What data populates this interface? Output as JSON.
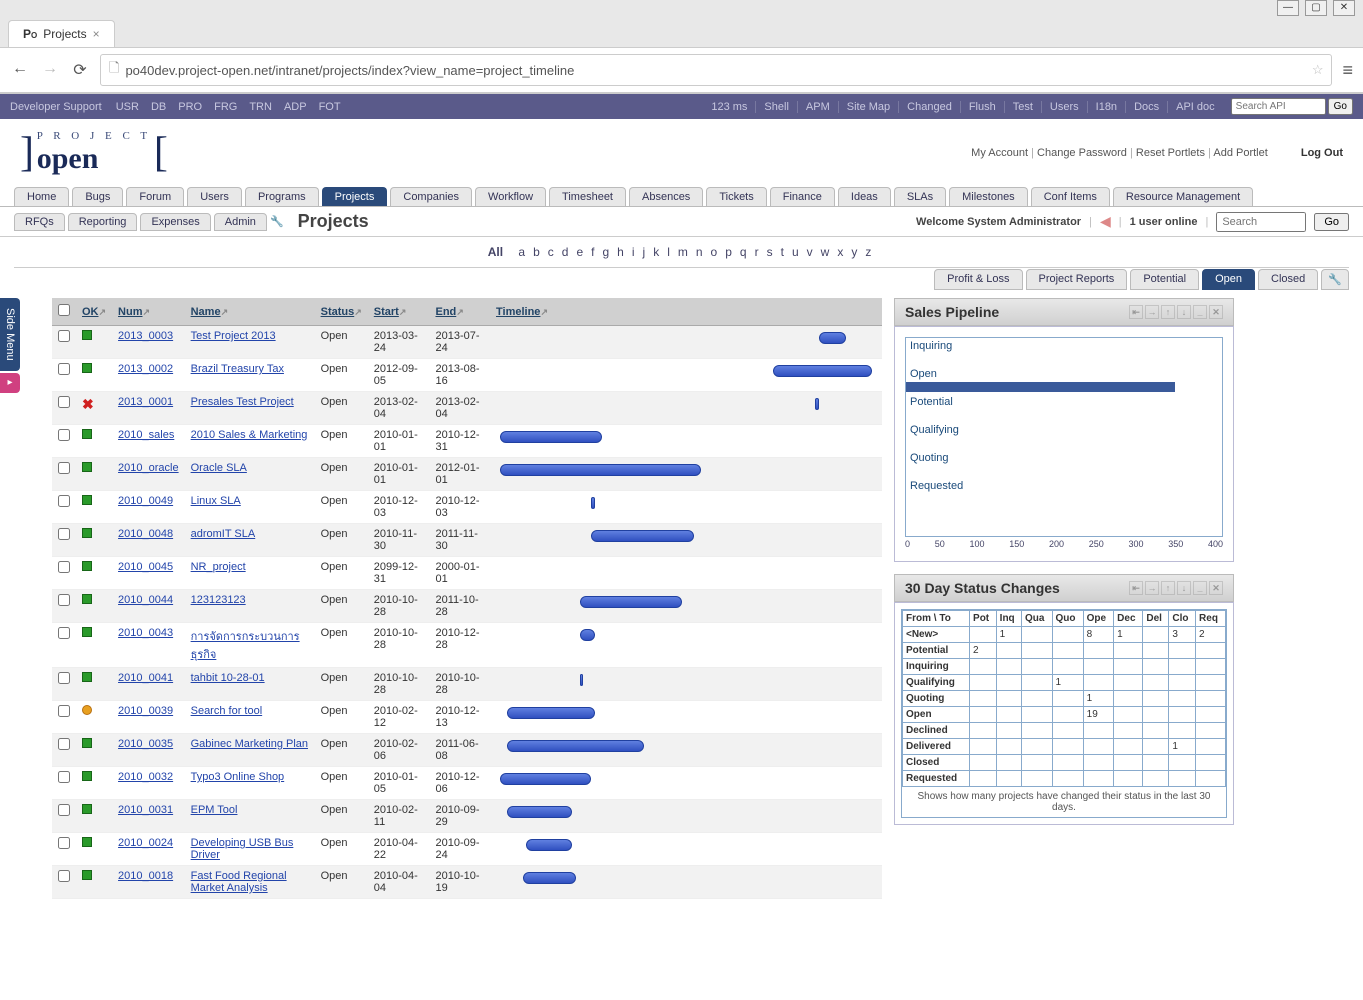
{
  "browser": {
    "tab_title": "Projects",
    "url": "po40dev.project-open.net/intranet/projects/index?view_name=project_timeline",
    "min_label": "—",
    "max_label": "▢",
    "close_label": "✕"
  },
  "dev_bar": {
    "label": "Developer Support",
    "left": [
      "USR",
      "DB",
      "PRO",
      "FRG",
      "TRN",
      "ADP",
      "FOT"
    ],
    "right": [
      "123 ms",
      "Shell",
      "APM",
      "Site Map",
      "Changed",
      "Flush",
      "Test",
      "Users",
      "I18n",
      "Docs",
      "API doc"
    ],
    "search_placeholder": "Search API",
    "go": "Go"
  },
  "header": {
    "account_links": [
      "My Account",
      "Change Password",
      "Reset Portlets",
      "Add Portlet"
    ],
    "logout": "Log Out",
    "logo_top": "P R O J E C T",
    "logo_bottom": "open"
  },
  "main_tabs": [
    "Home",
    "Bugs",
    "Forum",
    "Users",
    "Programs",
    "Projects",
    "Companies",
    "Workflow",
    "Timesheet",
    "Absences",
    "Tickets",
    "Finance",
    "Ideas",
    "SLAs",
    "Milestones",
    "Conf Items",
    "Resource Management"
  ],
  "main_tab_active": "Projects",
  "sub_tabs": [
    "RFQs",
    "Reporting",
    "Expenses",
    "Admin"
  ],
  "page_title": "Projects",
  "welcome": {
    "text": "Welcome System Administrator",
    "online": "1 user online",
    "search_placeholder": "Search",
    "go": "Go"
  },
  "alpha": {
    "all": "All",
    "letters": [
      "a",
      "b",
      "c",
      "d",
      "e",
      "f",
      "g",
      "h",
      "i",
      "j",
      "k",
      "l",
      "m",
      "n",
      "o",
      "p",
      "q",
      "r",
      "s",
      "t",
      "u",
      "v",
      "w",
      "x",
      "y",
      "z"
    ]
  },
  "view_tabs": [
    "Profit & Loss",
    "Project Reports",
    "Potential",
    "Open",
    "Closed"
  ],
  "view_tab_active": "Open",
  "columns": {
    "ok": "OK",
    "num": "Num",
    "name": "Name",
    "status": "Status",
    "start": "Start",
    "end": "End",
    "timeline": "Timeline"
  },
  "side_menu_label": "Side Menu",
  "projects": [
    {
      "ok": "green",
      "num": "2013_0003",
      "name": "Test Project 2013",
      "status": "Open",
      "start": "2013-03-24",
      "end": "2013-07-24",
      "tl_left": 85,
      "tl_width": 7
    },
    {
      "ok": "green",
      "num": "2013_0002",
      "name": "Brazil Treasury Tax",
      "status": "Open",
      "start": "2012-09-05",
      "end": "2013-08-16",
      "tl_left": 73,
      "tl_width": 26
    },
    {
      "ok": "red",
      "num": "2013_0001",
      "name": "Presales Test Project",
      "status": "Open",
      "start": "2013-02-04",
      "end": "2013-02-04",
      "tl_left": 84,
      "tl_width": 1
    },
    {
      "ok": "green",
      "num": "2010_sales",
      "name": "2010 Sales & Marketing",
      "status": "Open",
      "start": "2010-01-01",
      "end": "2010-12-31",
      "tl_left": 1,
      "tl_width": 27
    },
    {
      "ok": "green",
      "num": "2010_oracle",
      "name": "Oracle SLA",
      "status": "Open",
      "start": "2010-01-01",
      "end": "2012-01-01",
      "tl_left": 1,
      "tl_width": 53
    },
    {
      "ok": "green",
      "num": "2010_0049",
      "name": "Linux SLA",
      "status": "Open",
      "start": "2010-12-03",
      "end": "2010-12-03",
      "tl_left": 25,
      "tl_width": 1
    },
    {
      "ok": "green",
      "num": "2010_0048",
      "name": "adromIT SLA",
      "status": "Open",
      "start": "2010-11-30",
      "end": "2011-11-30",
      "tl_left": 25,
      "tl_width": 27
    },
    {
      "ok": "green",
      "num": "2010_0045",
      "name": "NR_project",
      "status": "Open",
      "start": "2099-12-31",
      "end": "2000-01-01",
      "tl_left": 0,
      "tl_width": 0
    },
    {
      "ok": "green",
      "num": "2010_0044",
      "name": "123123123",
      "status": "Open",
      "start": "2010-10-28",
      "end": "2011-10-28",
      "tl_left": 22,
      "tl_width": 27
    },
    {
      "ok": "green",
      "num": "2010_0043",
      "name": "การจัดการกระบวนการธุรกิจ",
      "status": "Open",
      "start": "2010-10-28",
      "end": "2010-12-28",
      "tl_left": 22,
      "tl_width": 4
    },
    {
      "ok": "green",
      "num": "2010_0041",
      "name": "tahbit 10-28-01",
      "status": "Open",
      "start": "2010-10-28",
      "end": "2010-10-28",
      "tl_left": 22,
      "tl_width": 1
    },
    {
      "ok": "orange",
      "num": "2010_0039",
      "name": "Search for tool",
      "status": "Open",
      "start": "2010-02-12",
      "end": "2010-12-13",
      "tl_left": 3,
      "tl_width": 23
    },
    {
      "ok": "green",
      "num": "2010_0035",
      "name": "Gabinec Marketing Plan",
      "status": "Open",
      "start": "2010-02-06",
      "end": "2011-06-08",
      "tl_left": 3,
      "tl_width": 36
    },
    {
      "ok": "green",
      "num": "2010_0032",
      "name": "Typo3 Online Shop",
      "status": "Open",
      "start": "2010-01-05",
      "end": "2010-12-06",
      "tl_left": 1,
      "tl_width": 24
    },
    {
      "ok": "green",
      "num": "2010_0031",
      "name": "EPM Tool",
      "status": "Open",
      "start": "2010-02-11",
      "end": "2010-09-29",
      "tl_left": 3,
      "tl_width": 17
    },
    {
      "ok": "green",
      "num": "2010_0024",
      "name": "Developing USB Bus Driver",
      "status": "Open",
      "start": "2010-04-22",
      "end": "2010-09-24",
      "tl_left": 8,
      "tl_width": 12
    },
    {
      "ok": "green",
      "num": "2010_0018",
      "name": "Fast Food Regional Market Analysis",
      "status": "Open",
      "start": "2010-04-04",
      "end": "2010-10-19",
      "tl_left": 7,
      "tl_width": 14
    }
  ],
  "chart_data": {
    "type": "bar",
    "title": "Sales Pipeline",
    "orientation": "horizontal",
    "categories": [
      "Inquiring",
      "Open",
      "Potential",
      "Qualifying",
      "Quoting",
      "Requested"
    ],
    "values": [
      0,
      340,
      0,
      0,
      0,
      0
    ],
    "xlim": [
      0,
      400
    ],
    "xticks": [
      0,
      50,
      100,
      150,
      200,
      250,
      300,
      350,
      400
    ]
  },
  "status_changes": {
    "title": "30 Day Status Changes",
    "header": [
      "From \\ To",
      "Pot",
      "Inq",
      "Qua",
      "Quo",
      "Ope",
      "Dec",
      "Del",
      "Clo",
      "Req"
    ],
    "rows": [
      {
        "label": "<New>",
        "cells": [
          "",
          "1",
          "",
          "",
          "8",
          "1",
          "",
          "3",
          "2"
        ]
      },
      {
        "label": "Potential",
        "cells": [
          "2",
          "",
          "",
          "",
          "",
          "",
          "",
          "",
          ""
        ]
      },
      {
        "label": "Inquiring",
        "cells": [
          "",
          "",
          "",
          "",
          "",
          "",
          "",
          "",
          ""
        ]
      },
      {
        "label": "Qualifying",
        "cells": [
          "",
          "",
          "",
          "1",
          "",
          "",
          "",
          "",
          ""
        ]
      },
      {
        "label": "Quoting",
        "cells": [
          "",
          "",
          "",
          "",
          "1",
          "",
          "",
          "",
          ""
        ]
      },
      {
        "label": "Open",
        "cells": [
          "",
          "",
          "",
          "",
          "19",
          "",
          "",
          "",
          ""
        ]
      },
      {
        "label": "Declined",
        "cells": [
          "",
          "",
          "",
          "",
          "",
          "",
          "",
          "",
          ""
        ]
      },
      {
        "label": "Delivered",
        "cells": [
          "",
          "",
          "",
          "",
          "",
          "",
          "",
          "1",
          ""
        ]
      },
      {
        "label": "Closed",
        "cells": [
          "",
          "",
          "",
          "",
          "",
          "",
          "",
          "",
          ""
        ]
      },
      {
        "label": "Requested",
        "cells": [
          "",
          "",
          "",
          "",
          "",
          "",
          "",
          "",
          ""
        ]
      }
    ],
    "caption": "Shows how many projects have changed their status in the last 30 days."
  }
}
